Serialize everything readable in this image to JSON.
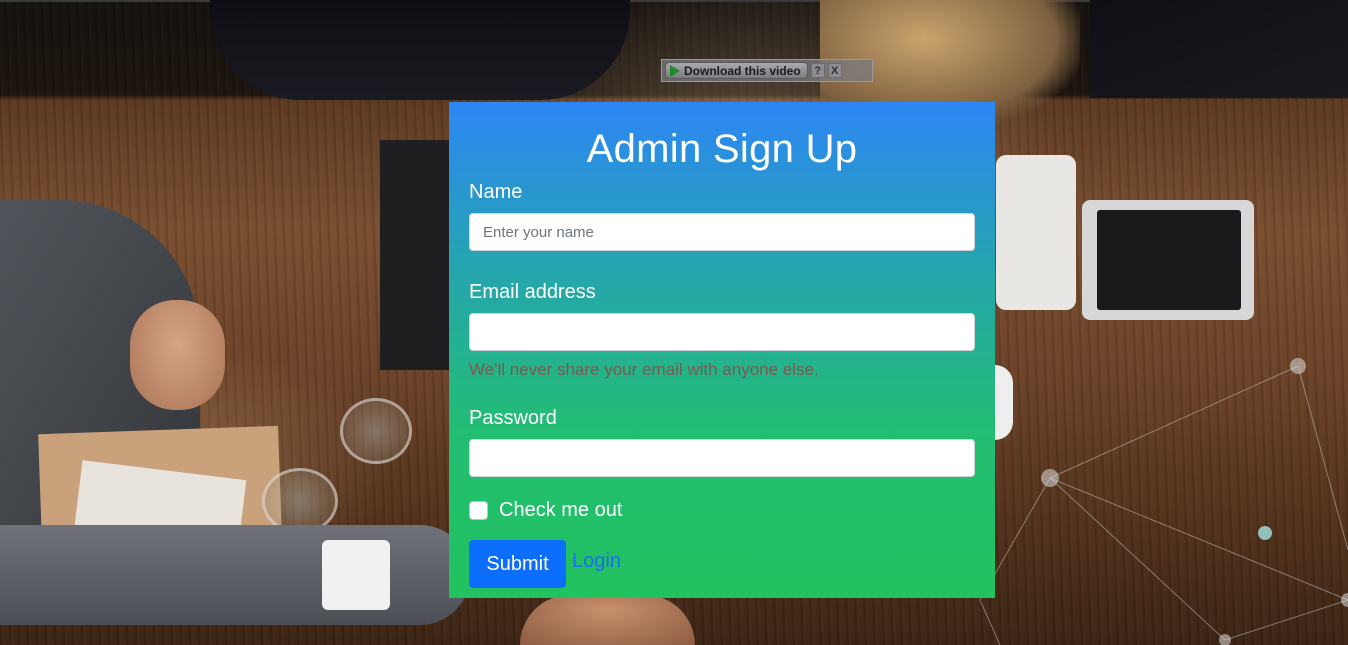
{
  "video_bar": {
    "download_label": "Download this video",
    "help_label": "?",
    "close_label": "X"
  },
  "form": {
    "title": "Admin Sign Up",
    "name_label": "Name",
    "name_placeholder": "Enter your name",
    "name_value": "",
    "email_label": "Email address",
    "email_value": "",
    "email_help": "We'll never share your email with anyone else.",
    "password_label": "Password",
    "password_value": "",
    "remember_label": "Check me out",
    "remember_checked": false,
    "submit_label": "Submit",
    "login_label": "Login"
  },
  "colors": {
    "card_top": "#2d86f5",
    "card_bottom": "#22c25f",
    "submit_bg": "#0d6efd",
    "link": "#1a6ef0",
    "help_text": "#7a5a4e"
  }
}
